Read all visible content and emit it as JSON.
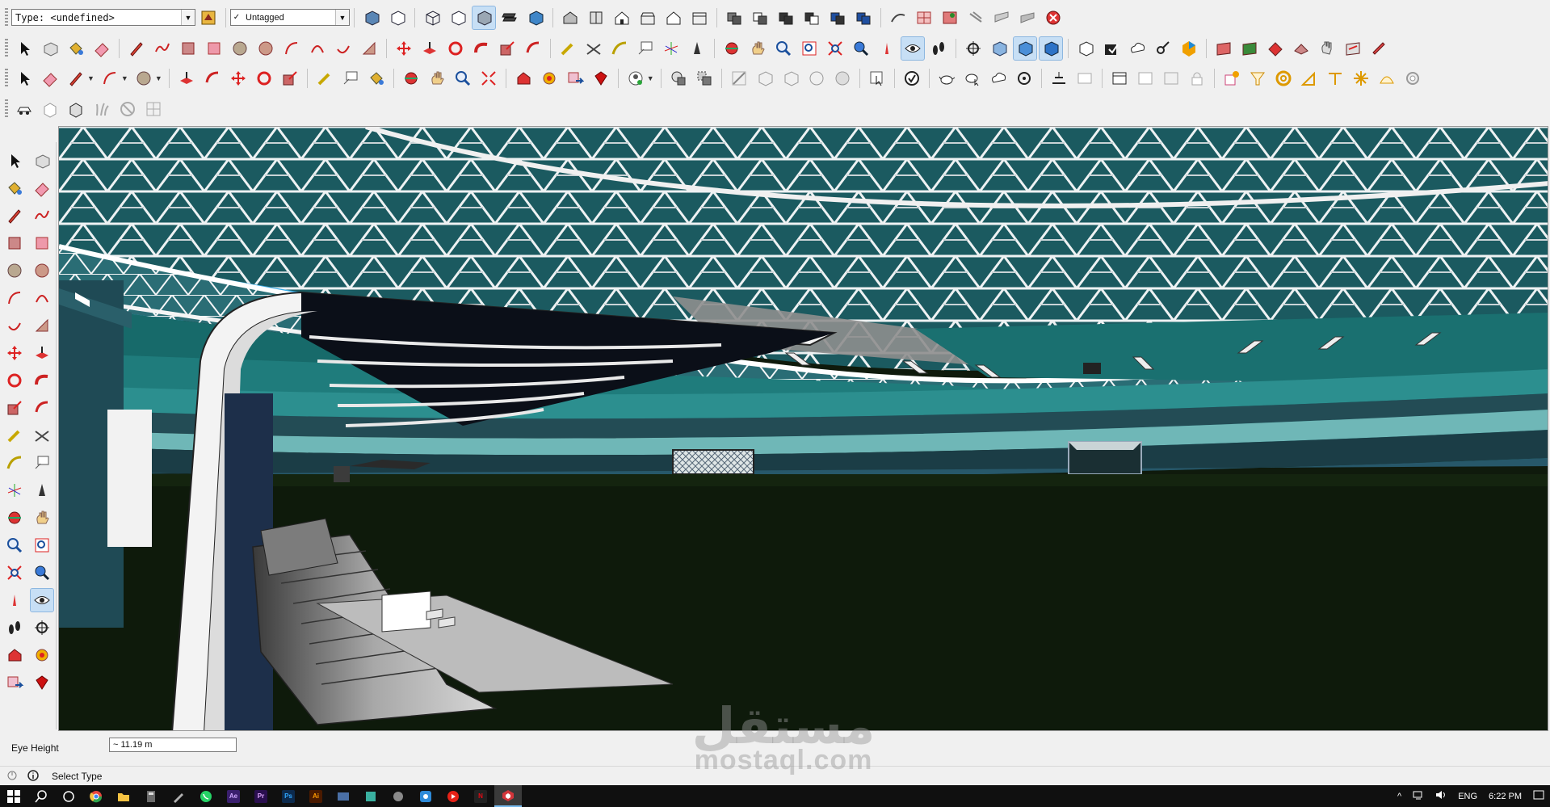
{
  "toolbar": {
    "type_select": {
      "value": "Type: <undefined>"
    },
    "tag_select": {
      "value": "Untagged",
      "check": "✓"
    }
  },
  "measurements": {
    "label": "Eye Height",
    "value": "~ 11.19 m"
  },
  "status": {
    "text": "Select Type"
  },
  "taskbar": {
    "apps": [
      {
        "name": "start",
        "glyph": "⊞",
        "color": "#ffffff"
      },
      {
        "name": "search",
        "glyph": "⚲",
        "color": "#ffffff"
      },
      {
        "name": "task-view",
        "glyph": "○",
        "color": "#ffffff"
      },
      {
        "name": "chrome",
        "glyph": "",
        "color": "#e8453c"
      },
      {
        "name": "file-explorer",
        "glyph": "",
        "color": "#f5c242"
      },
      {
        "name": "calculator",
        "glyph": "",
        "color": "#6b6b6b"
      },
      {
        "name": "pen-tool",
        "glyph": "",
        "color": "#b0b0b0"
      },
      {
        "name": "whatsapp",
        "glyph": "",
        "color": "#25d366"
      },
      {
        "name": "after-effects",
        "glyph": "Ae",
        "color": "#3a1f6e"
      },
      {
        "name": "premiere",
        "glyph": "Pr",
        "color": "#2a0f4f"
      },
      {
        "name": "photoshop",
        "glyph": "Ps",
        "color": "#0c2a4d"
      },
      {
        "name": "illustrator",
        "glyph": "Ai",
        "color": "#4a1a00"
      },
      {
        "name": "media-app",
        "glyph": "",
        "color": "#4a6fa5"
      },
      {
        "name": "notes-app",
        "glyph": "",
        "color": "#3ab0a0"
      },
      {
        "name": "game-app",
        "glyph": "",
        "color": "#8a8a8a"
      },
      {
        "name": "capture-app",
        "glyph": "",
        "color": "#2d8ad8"
      },
      {
        "name": "youtube",
        "glyph": "▶",
        "color": "#e62117"
      },
      {
        "name": "netflix",
        "glyph": "N",
        "color": "#b20710"
      },
      {
        "name": "sketchup",
        "glyph": "",
        "color": "#d2353a"
      }
    ],
    "tray": {
      "lang": "ENG",
      "time": "6:22 PM"
    }
  },
  "watermark": {
    "arabic": "مستقل",
    "latin": "mostaql.com"
  }
}
